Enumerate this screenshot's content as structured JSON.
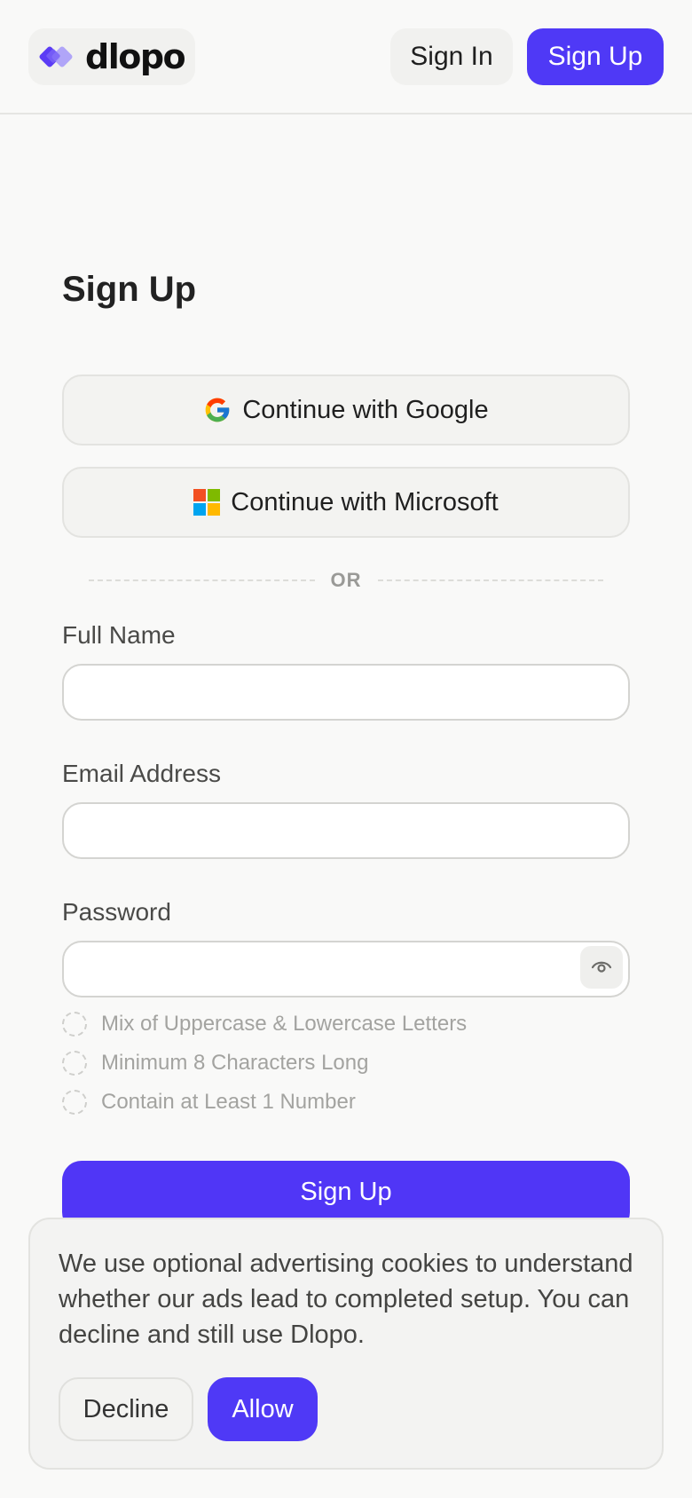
{
  "header": {
    "logo_text": "dlopo",
    "signin_label": "Sign In",
    "signup_label": "Sign Up",
    "brand_color": "#4f39f6"
  },
  "form": {
    "title": "Sign Up",
    "google_label": "Continue with Google",
    "microsoft_label": "Continue with Microsoft",
    "divider_text": "OR",
    "fields": [
      {
        "label": "Full Name",
        "value": ""
      },
      {
        "label": "Email Address",
        "value": ""
      },
      {
        "label": "Password",
        "value": ""
      }
    ],
    "password_rules": [
      "Mix of Uppercase & Lowercase Letters",
      "Minimum 8 Characters Long",
      "Contain at Least 1 Number"
    ],
    "submit_label": "Sign Up"
  },
  "cookie_banner": {
    "message": "We use optional advertising cookies to understand whether our ads lead to completed setup. You can decline and still use Dlopo.",
    "decline_label": "Decline",
    "allow_label": "Allow"
  },
  "icons": {
    "logo": "dlopo-logo-icon",
    "google": "google-icon",
    "microsoft": "microsoft-icon",
    "eye": "eye-icon",
    "rule_status": "dashed-circle-icon"
  }
}
